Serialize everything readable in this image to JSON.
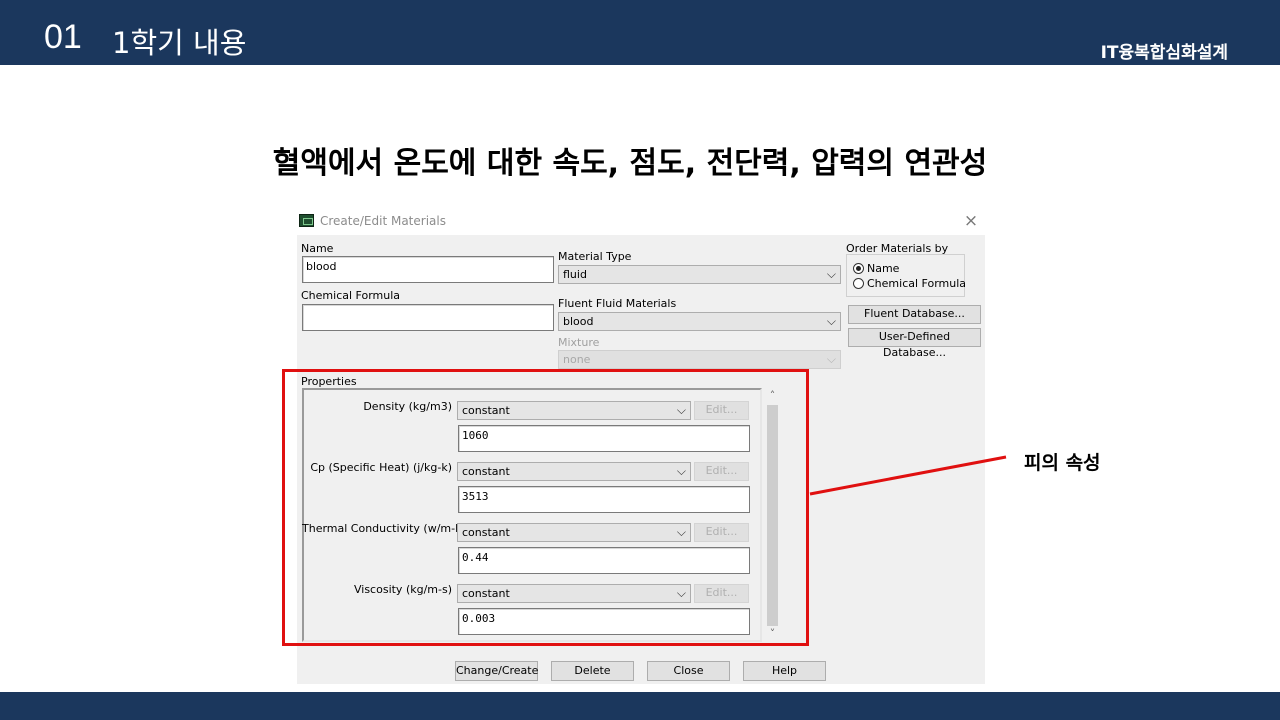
{
  "header": {
    "section_number": "01",
    "section_title": "1학기 내용",
    "organization": "IT융복합심화설계"
  },
  "slide_heading": "혈액에서 온도에 대한 속도, 점도, 전단력, 압력의 연관성",
  "dialog": {
    "title": "Create/Edit Materials",
    "close_glyph": "×",
    "name_label": "Name",
    "name_value": "blood",
    "chemical_formula_label": "Chemical Formula",
    "chemical_formula_value": "",
    "material_type_label": "Material Type",
    "material_type_value": "fluid",
    "fluent_fluid_materials_label": "Fluent Fluid Materials",
    "fluent_fluid_materials_value": "blood",
    "mixture_label": "Mixture",
    "mixture_value": "none",
    "order_by_label": "Order Materials by",
    "order_options": [
      "Name",
      "Chemical Formula"
    ],
    "order_selected": "Name",
    "fluent_database_button": "Fluent Database...",
    "user_defined_database_button": "User-Defined Database...",
    "properties_label": "Properties",
    "properties": [
      {
        "label": "Density (kg/m3)",
        "method": "constant",
        "edit": "Edit...",
        "value": "1060"
      },
      {
        "label": "Cp (Specific Heat) (j/kg-k)",
        "method": "constant",
        "edit": "Edit...",
        "value": "3513"
      },
      {
        "label": "Thermal Conductivity (w/m-k)",
        "method": "constant",
        "edit": "Edit...",
        "value": "0.44"
      },
      {
        "label": "Viscosity (kg/m-s)",
        "method": "constant",
        "edit": "Edit...",
        "value": "0.003"
      }
    ],
    "scroll_up_glyph": "˄",
    "scroll_down_glyph": "˅",
    "combo_glyph": "⌵",
    "buttons": {
      "change_create": "Change/Create",
      "delete": "Delete",
      "close": "Close",
      "help": "Help"
    }
  },
  "callout_label": "피의 속성",
  "colors": {
    "header_bar": "#1b375d",
    "highlight": "#e01010",
    "dialog_bg": "#f0f0f0"
  }
}
